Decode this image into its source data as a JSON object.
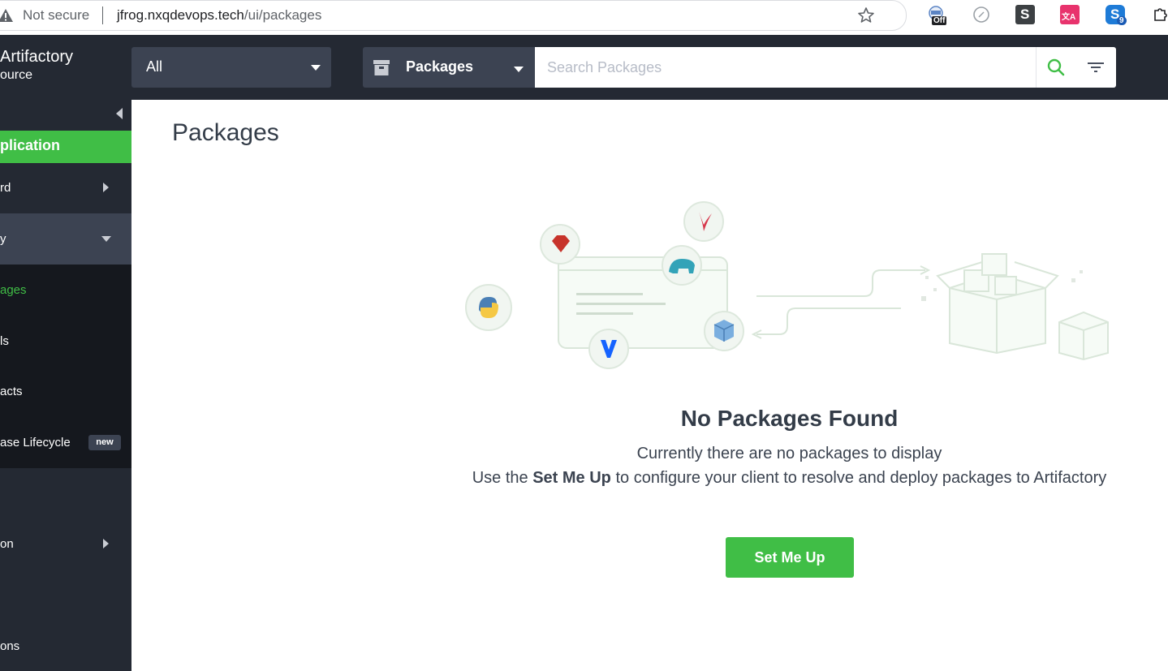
{
  "browser": {
    "security_label": "Not secure",
    "url_host": "jfrog.nxqdevops.tech",
    "url_path": "/ui/packages",
    "extensions": [
      {
        "name": "off-extension-icon",
        "badge": "Off"
      },
      {
        "name": "compass-extension-icon"
      },
      {
        "name": "s-extension-icon",
        "label": "S"
      },
      {
        "name": "translate-extension-icon",
        "label": "文A"
      },
      {
        "name": "skype-extension-icon",
        "label": "S",
        "badge": "9"
      },
      {
        "name": "puzzle-extension-icon"
      }
    ]
  },
  "header": {
    "brand_line1": "Artifactory",
    "brand_line2": "ource",
    "scope_value": "All",
    "package_select_value": "Packages",
    "search_placeholder": "Search Packages"
  },
  "sidebar": {
    "application_label": "plication",
    "items": [
      {
        "label": "rd"
      },
      {
        "label": "y"
      },
      {
        "label": "on"
      },
      {
        "label": "ons"
      }
    ],
    "sub_items": [
      {
        "label": "ages",
        "active": true
      },
      {
        "label": "ls"
      },
      {
        "label": "acts"
      },
      {
        "label": "ase Lifecycle",
        "badge": "new"
      }
    ]
  },
  "main": {
    "title": "Packages",
    "empty_title": "No Packages Found",
    "empty_line1": "Currently there are no packages to display",
    "empty_line2_prefix": "Use the",
    "empty_line2_bold": "Set Me Up",
    "empty_line2_suffix": "to configure your client to resolve and deploy packages to Artifactory",
    "setup_button_label": "Set Me Up"
  },
  "colors": {
    "header_bg": "#242933",
    "accent_green": "#40be46",
    "select_bg": "#3c4352",
    "subnav_bg": "#15181e"
  }
}
